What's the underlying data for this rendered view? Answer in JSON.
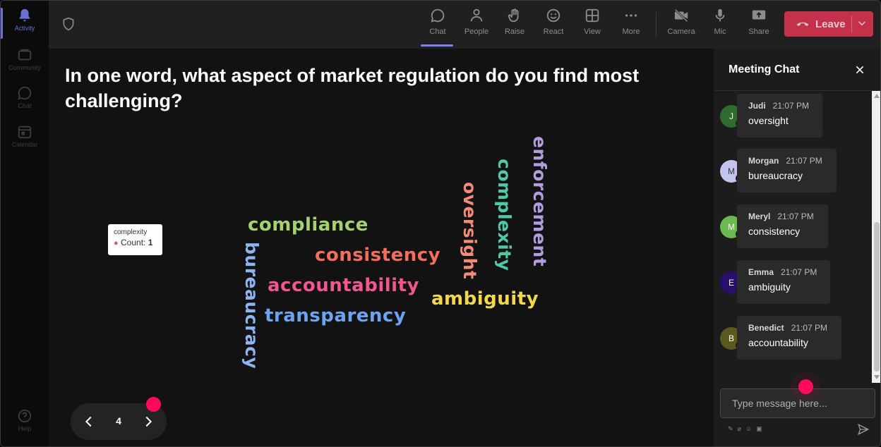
{
  "rail": [
    {
      "name": "activity",
      "label": "Activity",
      "icon": "bell-icon",
      "active": true
    },
    {
      "name": "community",
      "label": "Community",
      "icon": "community-icon",
      "active": false
    },
    {
      "name": "chat",
      "label": "Chat",
      "icon": "chat-icon",
      "active": false
    },
    {
      "name": "calendar",
      "label": "Calendar",
      "icon": "calendar-icon",
      "active": false
    },
    {
      "name": "help",
      "label": "Help",
      "icon": "help-icon",
      "active": false
    }
  ],
  "toolbar": {
    "chat": "Chat",
    "people": "People",
    "raise": "Raise",
    "react": "React",
    "view": "View",
    "more": "More",
    "camera": "Camera",
    "mic": "Mic",
    "share": "Share",
    "leave": "Leave"
  },
  "question": "In one word, what aspect of market regulation do you find most challenging?",
  "wordcloud": [
    {
      "text": "compliance",
      "color": "#a3d36f"
    },
    {
      "text": "consistency",
      "color": "#f26d5b"
    },
    {
      "text": "accountability",
      "color": "#f0568f"
    },
    {
      "text": "transparency",
      "color": "#6ea3f0"
    },
    {
      "text": "ambiguity",
      "color": "#f5d84a"
    },
    {
      "text": "bureaucracy",
      "color": "#8fb4f2"
    },
    {
      "text": "oversight",
      "color": "#f48a78"
    },
    {
      "text": "complexity",
      "color": "#4fc8a5"
    },
    {
      "text": "enforcement",
      "color": "#b39ce0"
    }
  ],
  "tooltip": {
    "word": "complexity",
    "label": "Count:",
    "count": "1"
  },
  "pager": {
    "page": "4"
  },
  "chat": {
    "title": "Meeting Chat",
    "input_placeholder": "Type message here...",
    "messages": [
      {
        "initial": "J",
        "name": "Judi",
        "time": "21:07 PM",
        "text": "oversight",
        "color": "#2e6b2e",
        "textColor": "#ffffff"
      },
      {
        "initial": "M",
        "name": "Morgan",
        "time": "21:07 PM",
        "text": "bureaucracy",
        "color": "#c2c5ee",
        "textColor": "#333333"
      },
      {
        "initial": "M",
        "name": "Meryl",
        "time": "21:07 PM",
        "text": "consistency",
        "color": "#6aba4f",
        "textColor": "#ffffff"
      },
      {
        "initial": "E",
        "name": "Emma",
        "time": "21:07 PM",
        "text": "ambiguity",
        "color": "#2a0e6b",
        "textColor": "#ffffff"
      },
      {
        "initial": "B",
        "name": "Benedict",
        "time": "21:07 PM",
        "text": "accountability",
        "color": "#5a5a1e",
        "textColor": "#ffffff"
      }
    ]
  },
  "colors": {
    "leave": "#c4314b",
    "accent": "#7b83eb",
    "pointer": "#ff0a5c"
  }
}
